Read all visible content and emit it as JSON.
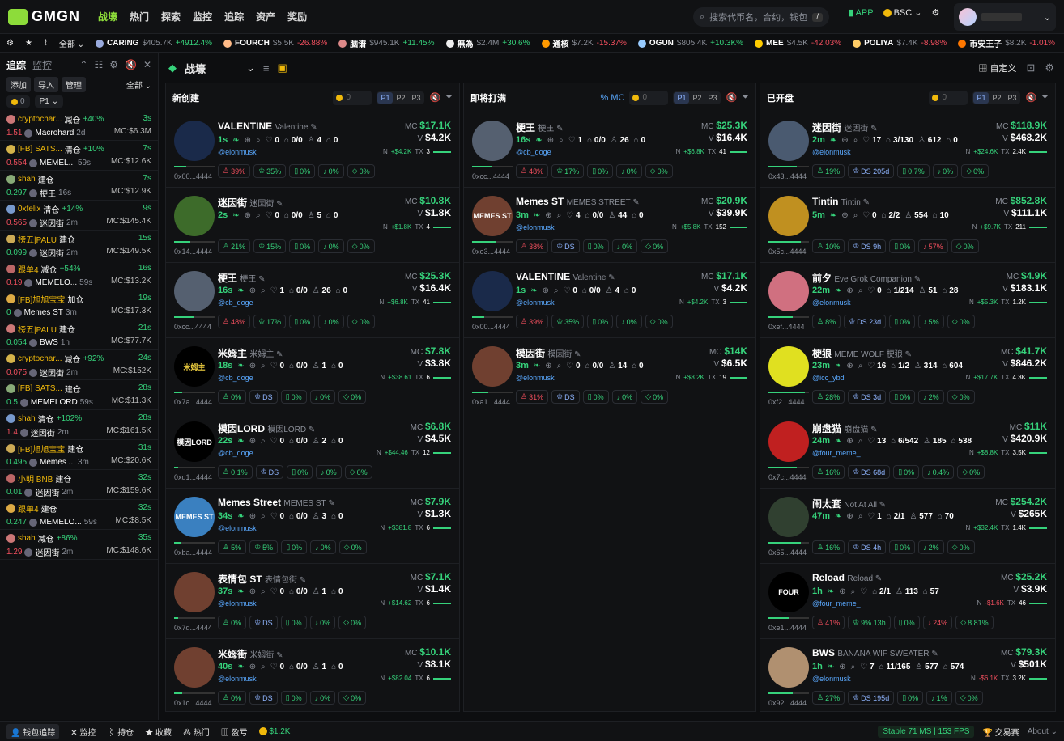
{
  "nav": {
    "brand": "GMGN",
    "items": [
      "战壕",
      "热门",
      "探索",
      "监控",
      "追踪",
      "资产",
      "奖励"
    ],
    "active": 0,
    "search_placeholder": "搜索代币名，合约，钱包",
    "search_key": "/",
    "app": "APP",
    "chain": "BSC"
  },
  "ticker": [
    {
      "name": "CARING",
      "mc": "$405.7K",
      "chg": "+4912.4%",
      "up": true
    },
    {
      "name": "FOURCH",
      "mc": "$5.5K",
      "chg": "-26.88%",
      "up": false
    },
    {
      "name": "脑谱",
      "mc": "$945.1K",
      "chg": "+11.45%",
      "up": true
    },
    {
      "name": "無為",
      "mc": "$2.4M",
      "chg": "+30.6%",
      "up": true
    },
    {
      "name": "通核",
      "mc": "$7.2K",
      "chg": "-15.37%",
      "up": false
    },
    {
      "name": "OGUN",
      "mc": "$805.4K",
      "chg": "+10.3K%",
      "up": true
    },
    {
      "name": "MEE",
      "mc": "$4.5K",
      "chg": "-42.03%",
      "up": false
    },
    {
      "name": "POLIYA",
      "mc": "$7.4K",
      "chg": "-8.98%",
      "up": false
    },
    {
      "name": "币安王子",
      "mc": "$8.2K",
      "chg": "-1.01%",
      "up": false
    }
  ],
  "ticker_filter": "全部",
  "sidebar": {
    "tab_active": "追踪",
    "tab_other": "监控",
    "add": "添加",
    "import": "导入",
    "manage": "管理",
    "filter": "全部",
    "amount": "0",
    "preset": "P1",
    "items": [
      {
        "who": "cryptochar...",
        "act": "减仓",
        "pct": "+40%",
        "age": "3s",
        "amt": "1.51",
        "token": "Macrohard",
        "tage": "2d",
        "mc": "$6.3M",
        "neg": true
      },
      {
        "who": "[FB] SATS...",
        "act": "清仓",
        "pct": "+10%",
        "age": "7s",
        "amt": "0.554",
        "token": "MEMEL...",
        "tage": "59s",
        "mc": "$12.6K",
        "neg": true
      },
      {
        "who": "shah",
        "act": "建仓",
        "pct": "",
        "age": "7s",
        "amt": "0.297",
        "token": "梗王",
        "tage": "16s",
        "mc": "$12.9K",
        "neg": false
      },
      {
        "who": "0xfelix",
        "act": "清仓",
        "pct": "+14%",
        "age": "9s",
        "amt": "0.565",
        "token": "迷因街",
        "tage": "2m",
        "mc": "$145.4K",
        "neg": true
      },
      {
        "who": "榜五|PALU",
        "act": "建仓",
        "pct": "",
        "age": "15s",
        "amt": "0.099",
        "token": "迷因街",
        "tage": "2m",
        "mc": "$149.5K",
        "neg": false
      },
      {
        "who": "跟单4",
        "act": "减仓",
        "pct": "+54%",
        "age": "16s",
        "amt": "0.19",
        "token": "MEMELO...",
        "tage": "59s",
        "mc": "$13.2K",
        "neg": true
      },
      {
        "who": "[FB]旭旭宝宝",
        "act": "加仓",
        "pct": "",
        "age": "19s",
        "amt": "0",
        "token": "Memes ST",
        "tage": "3m",
        "mc": "$17.3K",
        "neg": false
      },
      {
        "who": "榜五|PALU",
        "act": "建仓",
        "pct": "",
        "age": "21s",
        "amt": "0.054",
        "token": "BWS",
        "tage": "1h",
        "mc": "$77.7K",
        "neg": false
      },
      {
        "who": "cryptochar...",
        "act": "减仓",
        "pct": "+92%",
        "age": "24s",
        "amt": "0.075",
        "token": "迷因街",
        "tage": "2m",
        "mc": "$152K",
        "neg": true
      },
      {
        "who": "[FB] SATS...",
        "act": "建仓",
        "pct": "",
        "age": "28s",
        "amt": "0.5",
        "token": "MEMELORD",
        "tage": "59s",
        "mc": "$11.3K",
        "neg": false
      },
      {
        "who": "shah",
        "act": "清仓",
        "pct": "+102%",
        "age": "28s",
        "amt": "1.4",
        "token": "迷因街",
        "tage": "2m",
        "mc": "$161.5K",
        "neg": true
      },
      {
        "who": "[FB]旭旭宝宝",
        "act": "建仓",
        "pct": "",
        "age": "31s",
        "amt": "0.495",
        "token": "Memes ...",
        "tage": "3m",
        "mc": "$20.6K",
        "neg": false
      },
      {
        "who": "小明 BNB",
        "act": "建仓",
        "pct": "",
        "age": "32s",
        "amt": "0.01",
        "token": "迷因街",
        "tage": "2m",
        "mc": "$159.6K",
        "neg": false
      },
      {
        "who": "跟单4",
        "act": "建仓",
        "pct": "",
        "age": "32s",
        "amt": "0.247",
        "token": "MEMELO...",
        "tage": "59s",
        "mc": "$8.5K",
        "neg": false
      },
      {
        "who": "shah",
        "act": "减仓",
        "pct": "+86%",
        "age": "35s",
        "amt": "1.29",
        "token": "迷因街",
        "tage": "2m",
        "mc": "$148.6K",
        "neg": true
      }
    ]
  },
  "main": {
    "title": "战壕",
    "custom": "自定义"
  },
  "columns": [
    {
      "title": "新创建",
      "cards": [
        {
          "name": "VALENTINE",
          "sub": "Valentine",
          "age": "1s",
          "handle": "@elonmusk",
          "addr": "0x00...4444",
          "mc": "$17.1K",
          "v": "$4.2K",
          "n": "+$4.2K",
          "tx": "3",
          "stats": [
            "0",
            "0/0",
            "4",
            "0"
          ],
          "badges": [
            "39%",
            "35%",
            "0%",
            "0%",
            "0%"
          ],
          "bg": "#1a2a4a",
          "img": "",
          "prog": 0.3
        },
        {
          "name": "迷因街",
          "sub": "迷因街",
          "age": "2s",
          "handle": "",
          "addr": "0x14...4444",
          "mc": "$10.8K",
          "v": "$1.8K",
          "n": "+$1.8K",
          "tx": "4",
          "stats": [
            "0",
            "0/0",
            "5",
            "0"
          ],
          "badges": [
            "21%",
            "15%",
            "0%",
            "0%",
            "0%"
          ],
          "bg": "#3d6b2a",
          "img": "",
          "prog": 0.4
        },
        {
          "name": "梗王",
          "sub": "梗王",
          "age": "16s",
          "handle": "@cb_doge",
          "addr": "0xcc...4444",
          "mc": "$25.3K",
          "v": "$16.4K",
          "n": "+$6.8K",
          "tx": "41",
          "stats": [
            "1",
            "0/0",
            "26",
            "0"
          ],
          "badges": [
            "48%",
            "17%",
            "0%",
            "0%",
            "0%"
          ],
          "bg": "#556070",
          "img": "",
          "prog": 0.5
        },
        {
          "name": "米姆主",
          "sub": "米姆主",
          "age": "18s",
          "handle": "@cb_doge",
          "addr": "0x7a...4444",
          "mc": "$7.8K",
          "v": "$3.8K",
          "n": "+$38.61",
          "tx": "6",
          "stats": [
            "0",
            "0/0",
            "1",
            "0"
          ],
          "badges": [
            "0%",
            "DS",
            "0%",
            "0%",
            "0%"
          ],
          "bg": "#000",
          "img": "米姆主",
          "prog": 0.2
        },
        {
          "name": "模因LORD",
          "sub": "模因LORD",
          "age": "22s",
          "handle": "@cb_doge",
          "addr": "0xd1...4444",
          "mc": "$6.8K",
          "v": "$4.5K",
          "n": "+$44.46",
          "tx": "12",
          "stats": [
            "0",
            "0/0",
            "2",
            "0"
          ],
          "badges": [
            "0.1%",
            "DS",
            "0%",
            "0%",
            "0%"
          ],
          "bg": "#000",
          "img": "模因LORD",
          "prog": 0.1
        },
        {
          "name": "Memes Street",
          "sub": "MEMES ST",
          "age": "34s",
          "handle": "@elonmusk",
          "addr": "0xba...4444",
          "mc": "$7.9K",
          "v": "$1.3K",
          "n": "+$381.8",
          "tx": "6",
          "stats": [
            "0",
            "0/0",
            "3",
            "0"
          ],
          "badges": [
            "5%",
            "5%",
            "0%",
            "0%",
            "0%"
          ],
          "bg": "#3a80c0",
          "img": "MEMES ST",
          "prog": 0.15
        },
        {
          "name": "表情包 ST",
          "sub": "表情包街",
          "age": "37s",
          "handle": "@elonmusk",
          "addr": "0x7d...4444",
          "mc": "$7.1K",
          "v": "$1.4K",
          "n": "+$14.62",
          "tx": "6",
          "stats": [
            "0",
            "0/0",
            "1",
            "0"
          ],
          "badges": [
            "0%",
            "DS",
            "0%",
            "0%",
            "0%"
          ],
          "bg": "#704030",
          "img": "",
          "prog": 0.1
        },
        {
          "name": "米姆街",
          "sub": "米姆街",
          "age": "40s",
          "handle": "@elonmusk",
          "addr": "0x1c...4444",
          "mc": "$10.1K",
          "v": "$8.1K",
          "n": "+$82.04",
          "tx": "6",
          "stats": [
            "0",
            "0/0",
            "1",
            "0"
          ],
          "badges": [
            "0%",
            "DS",
            "0%",
            "0%",
            "0%"
          ],
          "bg": "#704030",
          "img": "",
          "prog": 0.2
        }
      ]
    },
    {
      "title": "即将打满",
      "cards": [
        {
          "name": "梗王",
          "sub": "梗王",
          "age": "16s",
          "handle": "@cb_doge",
          "addr": "0xcc...4444",
          "mc": "$25.3K",
          "v": "$16.4K",
          "n": "+$6.8K",
          "tx": "41",
          "stats": [
            "1",
            "0/0",
            "26",
            "0"
          ],
          "badges": [
            "48%",
            "17%",
            "0%",
            "0%",
            "0%"
          ],
          "bg": "#556070",
          "img": "",
          "prog": 0.5
        },
        {
          "name": "Memes ST",
          "sub": "MEMES STREET",
          "age": "3m",
          "handle": "@elonmusk",
          "addr": "0xe3...4444",
          "mc": "$20.9K",
          "v": "$39.9K",
          "n": "+$5.8K",
          "tx": "152",
          "stats": [
            "4",
            "0/0",
            "44",
            "0"
          ],
          "badges": [
            "38%",
            "DS",
            "0%",
            "0%",
            "0%"
          ],
          "bg": "#704030",
          "img": "MEMES ST",
          "prog": 0.6
        },
        {
          "name": "VALENTINE",
          "sub": "Valentine",
          "age": "1s",
          "handle": "@elonmusk",
          "addr": "0x00...4444",
          "mc": "$17.1K",
          "v": "$4.2K",
          "n": "+$4.2K",
          "tx": "3",
          "stats": [
            "0",
            "0/0",
            "4",
            "0"
          ],
          "badges": [
            "39%",
            "35%",
            "0%",
            "0%",
            "0%"
          ],
          "bg": "#1a2a4a",
          "img": "",
          "prog": 0.3
        },
        {
          "name": "模因街",
          "sub": "模因街",
          "age": "3m",
          "handle": "@elonmusk",
          "addr": "0xa1...4444",
          "mc": "$14K",
          "v": "$6.5K",
          "n": "+$3.2K",
          "tx": "19",
          "stats": [
            "0",
            "0/0",
            "14",
            "0"
          ],
          "badges": [
            "31%",
            "DS",
            "0%",
            "0%",
            "0%"
          ],
          "bg": "#704030",
          "img": "",
          "prog": 0.4
        }
      ]
    },
    {
      "title": "已开盘",
      "cards": [
        {
          "name": "迷因街",
          "sub": "迷因街",
          "age": "2m",
          "handle": "@elonmusk",
          "addr": "0x43...4444",
          "mc": "$118.9K",
          "v": "$468.2K",
          "n": "+$24.6K",
          "tx": "2.4K",
          "stats": [
            "17",
            "3/130",
            "612",
            "0"
          ],
          "badges": [
            "19%",
            "DS 205d",
            "0.7%",
            "0%",
            "0%"
          ],
          "bg": "#4a5a70",
          "img": "",
          "prog": 0.7
        },
        {
          "name": "Tintin",
          "sub": "Tintin",
          "age": "5m",
          "handle": "",
          "addr": "0x5c...4444",
          "mc": "$852.8K",
          "v": "$111.1K",
          "n": "+$9.7K",
          "tx": "211",
          "stats": [
            "0",
            "2/2",
            "554",
            "10"
          ],
          "badges": [
            "10%",
            "DS 9h",
            "0%",
            "57%",
            "0%"
          ],
          "bg": "#c09020",
          "img": "",
          "prog": 0.8
        },
        {
          "name": "前夕",
          "sub": "Eve Grok Companion",
          "age": "22m",
          "handle": "@elonmusk",
          "addr": "0xef...4444",
          "mc": "$4.9K",
          "v": "$183.1K",
          "n": "+$5.3K",
          "tx": "1.2K",
          "stats": [
            "0",
            "1/214",
            "51",
            "28"
          ],
          "badges": [
            "8%",
            "DS 23d",
            "0%",
            "5%",
            "0%"
          ],
          "bg": "#d07080",
          "img": "",
          "prog": 0.6
        },
        {
          "name": "梗狼",
          "sub": "MEME WOLF 梗狼",
          "age": "23m",
          "handle": "@icc_ybd",
          "addr": "0xf2...4444",
          "mc": "$41.7K",
          "v": "$846.2K",
          "n": "+$17.7K",
          "tx": "4.3K",
          "stats": [
            "16",
            "1/2",
            "314",
            "604"
          ],
          "badges": [
            "28%",
            "DS 3d",
            "0%",
            "2%",
            "0%"
          ],
          "bg": "#e0e020",
          "img": "",
          "prog": 0.9
        },
        {
          "name": "崩盘猫",
          "sub": "崩盘猫",
          "age": "24m",
          "handle": "@four_meme_",
          "addr": "0x7c...4444",
          "mc": "$11K",
          "v": "$420.9K",
          "n": "+$8.8K",
          "tx": "3.5K",
          "stats": [
            "13",
            "6/542",
            "185",
            "538"
          ],
          "badges": [
            "16%",
            "DS 68d",
            "0%",
            "0.4%",
            "0%"
          ],
          "bg": "#c02020",
          "img": "",
          "prog": 0.7
        },
        {
          "name": "闹太套",
          "sub": "Not At All",
          "age": "47m",
          "handle": "",
          "addr": "0x65...4444",
          "mc": "$254.2K",
          "v": "$265K",
          "n": "+$32.4K",
          "tx": "1.4K",
          "stats": [
            "1",
            "2/1",
            "577",
            "70"
          ],
          "badges": [
            "16%",
            "DS 4h",
            "0%",
            "2%",
            "0%"
          ],
          "bg": "#304030",
          "img": "",
          "prog": 0.8
        },
        {
          "name": "Reload",
          "sub": "Reload",
          "age": "1h",
          "handle": "@four_meme_",
          "addr": "0xe1...4444",
          "mc": "$25.2K",
          "v": "$3.9K",
          "n": "-$1.6K",
          "tx": "46",
          "stats": [
            "",
            "2/1",
            "113",
            "57"
          ],
          "badges": [
            "41%",
            "9% 13h",
            "0%",
            "24%",
            "8.81%"
          ],
          "bg": "#000",
          "img": "FOUR",
          "prog": 0.5
        },
        {
          "name": "BWS",
          "sub": "BANANA WIF SWEATER",
          "age": "1h",
          "handle": "@elonmusk",
          "addr": "0x92...4444",
          "mc": "$79.3K",
          "v": "$501K",
          "n": "-$6.1K",
          "tx": "3.2K",
          "stats": [
            "7",
            "11/165",
            "577",
            "574"
          ],
          "badges": [
            "27%",
            "DS 195d",
            "0%",
            "1%",
            "0%"
          ],
          "bg": "#b09070",
          "img": "",
          "prog": 0.6
        }
      ]
    }
  ],
  "bottom": {
    "items": [
      "钱包追踪",
      "监控",
      "持仓",
      "收藏",
      "热门",
      "盈亏"
    ],
    "bal": "$1.2K",
    "status": "Stable 71 MS | 153 FPS",
    "contest": "交易赛",
    "about": "About"
  }
}
